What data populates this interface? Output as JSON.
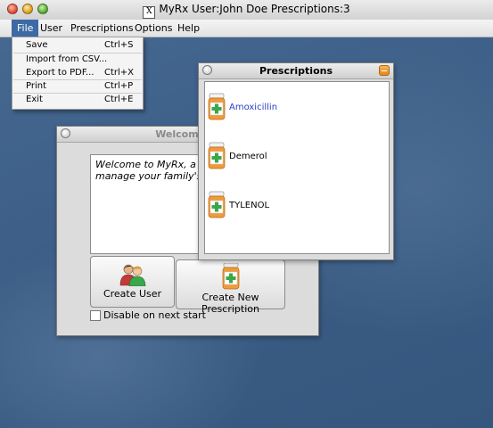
{
  "window": {
    "title": "MyRx User:John Doe  Prescriptions:3",
    "x_icon_glyph": "X"
  },
  "menubar": {
    "items": [
      {
        "label": "File"
      },
      {
        "label": "User"
      },
      {
        "label": "Prescriptions"
      },
      {
        "label": "Options"
      },
      {
        "label": "Help"
      }
    ],
    "active": "File"
  },
  "file_menu": {
    "items": [
      {
        "label": "Save",
        "shortcut": "Ctrl+S"
      },
      {
        "label": "Import from CSV...",
        "shortcut": ""
      },
      {
        "label": "Export to PDF...",
        "shortcut": "Ctrl+X"
      },
      {
        "label": "Print",
        "shortcut": "Ctrl+P"
      },
      {
        "label": "Exit",
        "shortcut": "Ctrl+E"
      }
    ]
  },
  "welcome_window": {
    "title": "Welcome to",
    "text": "Welcome to MyRx, a co\nmanage your family's m",
    "create_user_label": "Create User",
    "create_prescription_label": "Create New Prescription",
    "disable_label": "Disable on next start",
    "disable_checked": false
  },
  "prescriptions_window": {
    "title": "Prescriptions",
    "items": [
      {
        "name": "Amoxicillin",
        "selected": true
      },
      {
        "name": "Demerol",
        "selected": false
      },
      {
        "name": "TYLENOL",
        "selected": false
      }
    ]
  },
  "colors": {
    "accent": "#3d6aa5",
    "desktop": "#3c5e86",
    "selected_text": "#2a3fc0",
    "pill_bottle": "#f09a3a",
    "pill_cross": "#3aa84a"
  }
}
